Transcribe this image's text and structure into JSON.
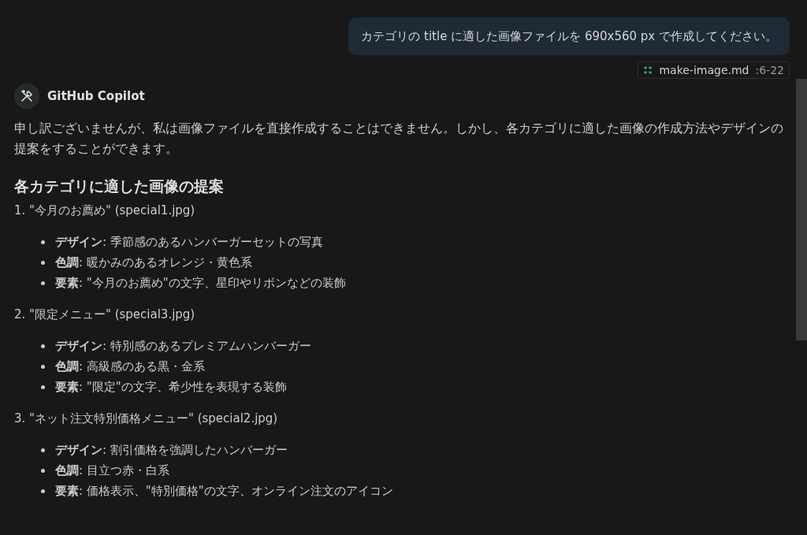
{
  "user_message": {
    "text": "カテゴリの title に適した画像ファイルを 690x560 px で作成してください。"
  },
  "reference": {
    "file": "make-image.md",
    "lines": ":6-22"
  },
  "response": {
    "author": "GitHub Copilot",
    "intro": "申し訳ございませんが、私は画像ファイルを直接作成することはできません。しかし、各カテゴリに適した画像の作成方法やデザインの提案をすることができます。",
    "heading": "各カテゴリに適した画像の提案",
    "sections": [
      {
        "title": "1. \"今月のお薦め\" (special1.jpg)",
        "bullets": [
          "**デザイン**: 季節感のあるハンバーガーセットの写真",
          "**色調**: 暖かみのあるオレンジ・黄色系",
          "**要素**: \"今月のお薦め\"の文字、星印やリボンなどの装飾"
        ]
      },
      {
        "title": "2. \"限定メニュー\" (special3.jpg)",
        "bullets": [
          "**デザイン**: 特別感のあるプレミアムハンバーガー",
          "**色調**: 高級感のある黒・金系",
          "**要素**: \"限定\"の文字、希少性を表現する装飾"
        ]
      },
      {
        "title": "3. \"ネット注文特別価格メニュー\" (special2.jpg)",
        "bullets": [
          "**デザイン**: 割引価格を強調したハンバーガー",
          "**色調**: 目立つ赤・白系",
          "**要素**: 価格表示、\"特別価格\"の文字、オンライン注文のアイコン"
        ]
      }
    ]
  }
}
